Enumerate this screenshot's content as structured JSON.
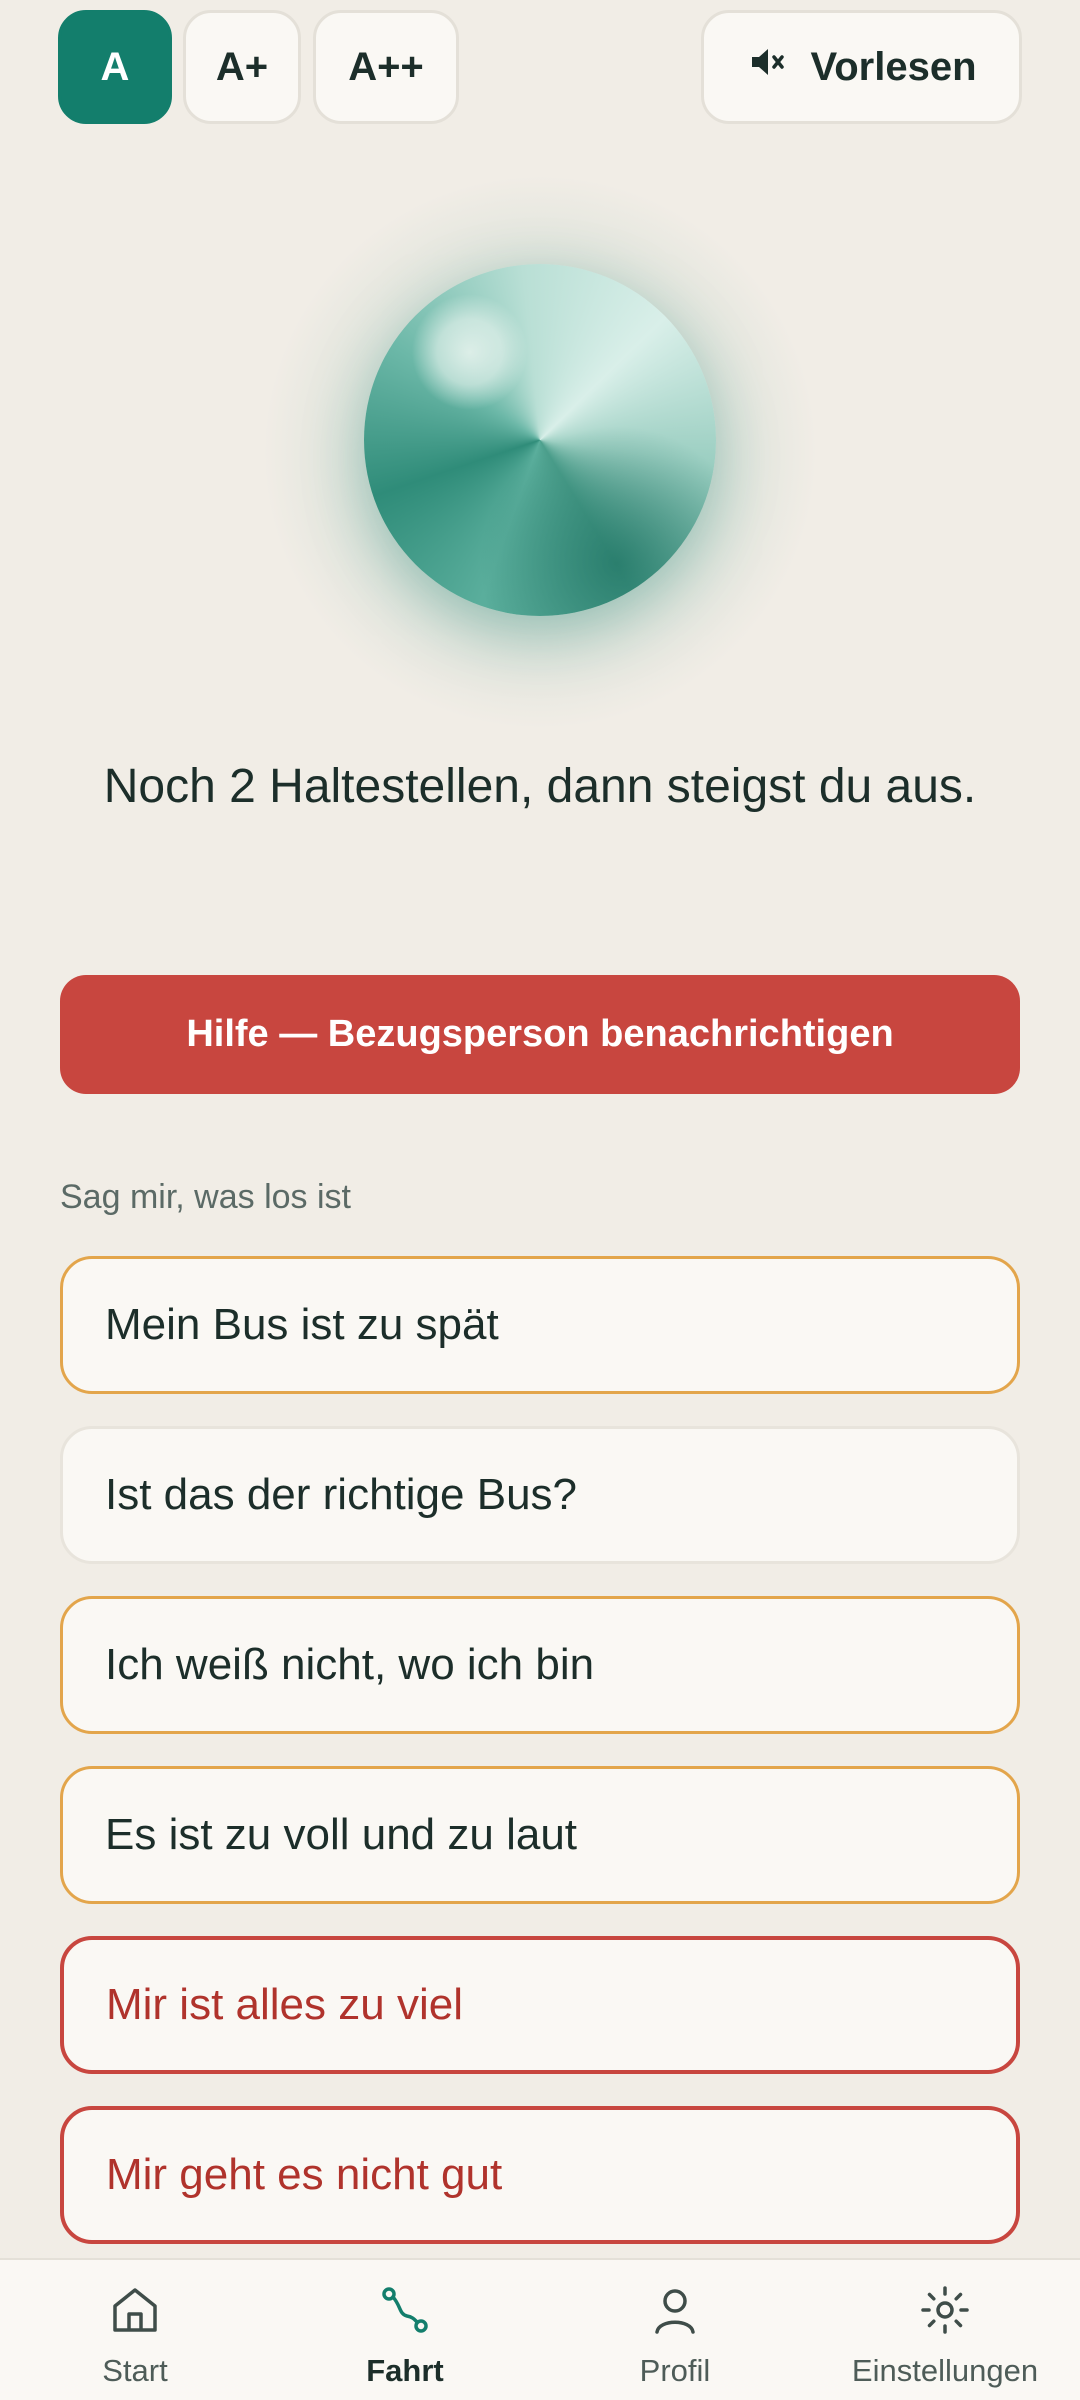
{
  "font_size_options": {
    "a": "A",
    "a_plus": "A+",
    "a_plus_plus": "A++",
    "selected": "A"
  },
  "read_aloud": {
    "label": "Vorlesen",
    "icon": "speaker-muted-icon"
  },
  "status": {
    "message": "Noch 2 Haltestellen, dann steigst du aus."
  },
  "help_button": {
    "label": "Hilfe — Bezugsperson benachrichtigen"
  },
  "issues": {
    "heading": "Sag mir, was los ist",
    "options": [
      {
        "label": "Mein Bus ist zu spät"
      },
      {
        "label": "Ist das der richtige Bus?"
      },
      {
        "label": "Ich weiß nicht, wo ich bin"
      },
      {
        "label": "Es ist zu voll und zu laut"
      },
      {
        "label": "Mir ist alles zu viel"
      },
      {
        "label": "Mir geht es nicht gut"
      }
    ]
  },
  "nav": {
    "items": [
      {
        "label": "Start",
        "icon": "home-icon"
      },
      {
        "label": "Fahrt",
        "icon": "route-icon",
        "active": true
      },
      {
        "label": "Profil",
        "icon": "person-icon"
      },
      {
        "label": "Einstellungen",
        "icon": "gear-icon"
      }
    ]
  },
  "colors": {
    "accent": "#137e6c",
    "danger": "#c8463f",
    "warning_border": "#e3a54b",
    "background": "#f1ede6"
  }
}
